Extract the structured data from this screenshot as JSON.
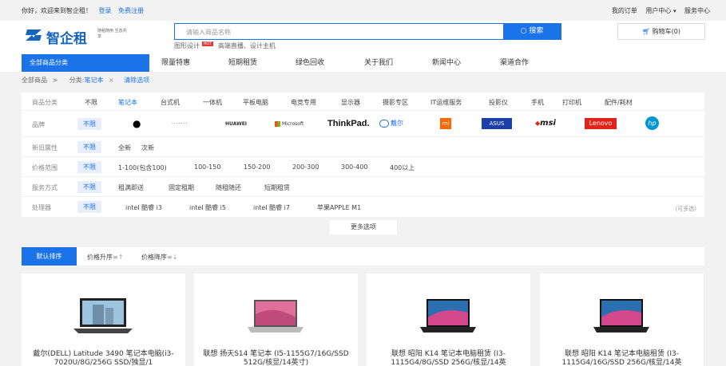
{
  "topbar": {
    "welcome": "你好，欢迎来到智企租！",
    "login": "登录",
    "register": "免费注册",
    "my_orders": "我的订单",
    "user_center": "用户中心",
    "service_center": "服务中心"
  },
  "header": {
    "brand": "智企租",
    "slogan": "随租随用 生态共享",
    "search_placeholder": "请输入商品名称",
    "search_button": "搜索",
    "hot_words": [
      "图形设计",
      "高端直播、设计主机"
    ],
    "hot_badge": "HOT",
    "cart": "购物车(0)"
  },
  "nav": {
    "all_categories": "全部商品分类",
    "items": [
      "限量特惠",
      "短期租赁",
      "绿色回收",
      "关于我们",
      "新闻中心",
      "渠道合作"
    ]
  },
  "crumb": {
    "all": "全部商品",
    "category_label": "分类:",
    "category_value": "笔记本",
    "clear": "清除选项"
  },
  "filters": {
    "any": "不限",
    "category": {
      "label": "商品分类",
      "options": [
        "笔记本",
        "台式机",
        "一体机",
        "平板电脑",
        "电竞专用",
        "显示器",
        "摄影专区",
        "IT运维服务",
        "投影仪",
        "手机",
        "打印机",
        "配件/耗材"
      ]
    },
    "brand": {
      "label": "品牌",
      "options": [
        "Apple",
        "·······",
        "HUAWEI",
        "Microsoft",
        "ThinkPad.",
        "戴尔",
        "mi",
        "ASUS",
        "msi",
        "Lenovo",
        "hp"
      ]
    },
    "condition": {
      "label": "新旧属性",
      "options": [
        "全新",
        "次新"
      ]
    },
    "price": {
      "label": "价格范围",
      "options": [
        "1-100(包含100)",
        "100-150",
        "150-200",
        "200-300",
        "300-400",
        "400以上"
      ]
    },
    "service": {
      "label": "服务方式",
      "options": [
        "租满即送",
        "固定租期",
        "随租随还",
        "短期租赁"
      ]
    },
    "cpu": {
      "label": "处理器",
      "options": [
        "intel 酷睿 i3",
        "intel 酷睿 i5",
        "intel 酷睿 i7",
        "苹果APPLE M1"
      ],
      "multi": "(可多选)"
    },
    "more": "更多选项"
  },
  "sort": {
    "default": "默认排序",
    "price_asc": "价格升序",
    "price_desc": "价格降序"
  },
  "products": [
    {
      "title": "戴尔(DELL) Latitude 3490 笔记本电脑(i3-7020U/8G/256G SSD/独显/1"
    },
    {
      "title": "联想 扬天S14 笔记本 (I5-1155G7/16G/SSD 512G/核显/14英寸)"
    },
    {
      "title": "联想 昭阳 K14 笔记本电脑租赁 (I3-1115G4/8G/SSD 256G/核显/14英"
    },
    {
      "title": "联想 昭阳 K14 笔记本电脑租赁 (I3-1115G4/16G/SSD 256G/核显/14英"
    }
  ],
  "colors": {
    "accent": "#1a73e8",
    "hot": "#e53935",
    "lenovo": "#e2231a",
    "mi": "#ff6700"
  }
}
